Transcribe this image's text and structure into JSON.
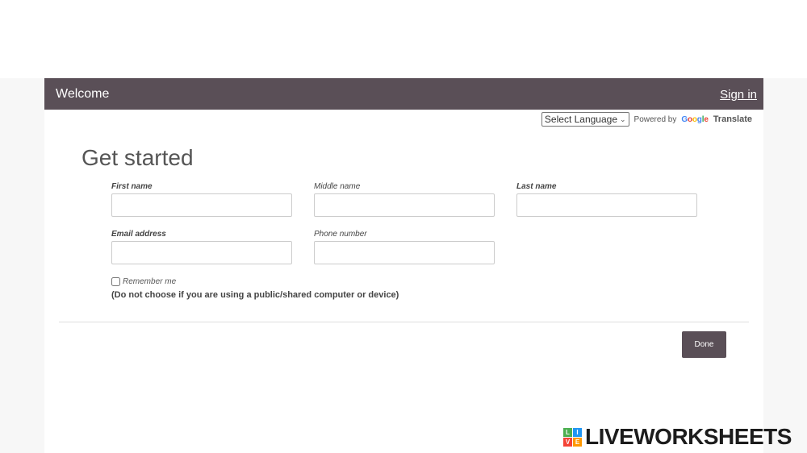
{
  "header": {
    "title": "Welcome",
    "signin_label": "Sign in"
  },
  "translate": {
    "select_label": "Select Language",
    "powered_by": "Powered by",
    "google_letters": [
      "G",
      "o",
      "o",
      "g",
      "l",
      "e"
    ],
    "translate_word": "Translate"
  },
  "form": {
    "heading": "Get started",
    "first_name": {
      "label": "First name",
      "value": ""
    },
    "middle_name": {
      "label": "Middle name",
      "value": ""
    },
    "last_name": {
      "label": "Last name",
      "value": ""
    },
    "email": {
      "label": "Email address",
      "value": ""
    },
    "phone": {
      "label": "Phone number",
      "value": ""
    },
    "remember_label": "Remember me",
    "remember_checked": false,
    "remember_note": "(Do not choose if you are using a public/shared computer or device)",
    "done_label": "Done"
  },
  "brand": {
    "icon_letters": [
      "L",
      "I",
      "V",
      "E"
    ],
    "icon_colors": [
      "#4caf50",
      "#2196f3",
      "#f44336",
      "#ff9800"
    ],
    "name": "LIVEWORKSHEETS"
  },
  "colors": {
    "header_bg": "#5a4f57",
    "button_bg": "#5a4f57"
  }
}
